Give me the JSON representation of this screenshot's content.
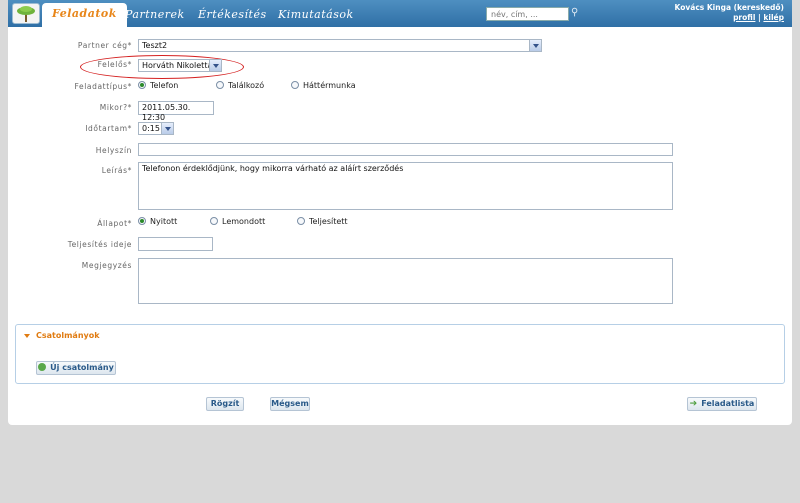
{
  "nav": {
    "tabs": [
      {
        "label": "Feladatok"
      },
      {
        "label": "Partnerek"
      },
      {
        "label": "Értékesítés"
      },
      {
        "label": "Kimutatások"
      }
    ],
    "search_placeholder": "név, cím, ...",
    "user_name": "Kovács Kinga (kereskedő)",
    "profile_link": "profil",
    "logout_link": "kilép"
  },
  "form": {
    "partner_label": "Partner cég*",
    "partner_value": "Teszt2",
    "responsible_label": "Felelős*",
    "responsible_value": "Horváth Nikoletta",
    "type_label": "Feladattípus*",
    "type_options": [
      "Telefon",
      "Találkozó",
      "Háttérmunka"
    ],
    "type_selected": "Telefon",
    "when_label": "Mikor?*",
    "when_value": "2011.05.30. 12:30",
    "duration_label": "Időtartam*",
    "duration_value": "0:15",
    "location_label": "Helyszín",
    "location_value": "",
    "description_label": "Leírás*",
    "description_value": "Telefonon érdeklődjünk, hogy mikorra várható az aláírt szerződés",
    "status_label": "Állapot*",
    "status_options": [
      "Nyitott",
      "Lemondott",
      "Teljesített"
    ],
    "status_selected": "Nyitott",
    "completion_label": "Teljesítés ideje",
    "completion_value": "",
    "note_label": "Megjegyzés",
    "note_value": ""
  },
  "attachments": {
    "title": "Csatolmányok",
    "new_button": "Új csatolmány"
  },
  "actions": {
    "save": "Rögzít",
    "cancel": "Mégsem",
    "task_list": "Feladatlista"
  },
  "colors": {
    "header_blue": "#3a7db3",
    "accent_orange": "#e8861a",
    "highlight_red": "#d42020"
  }
}
